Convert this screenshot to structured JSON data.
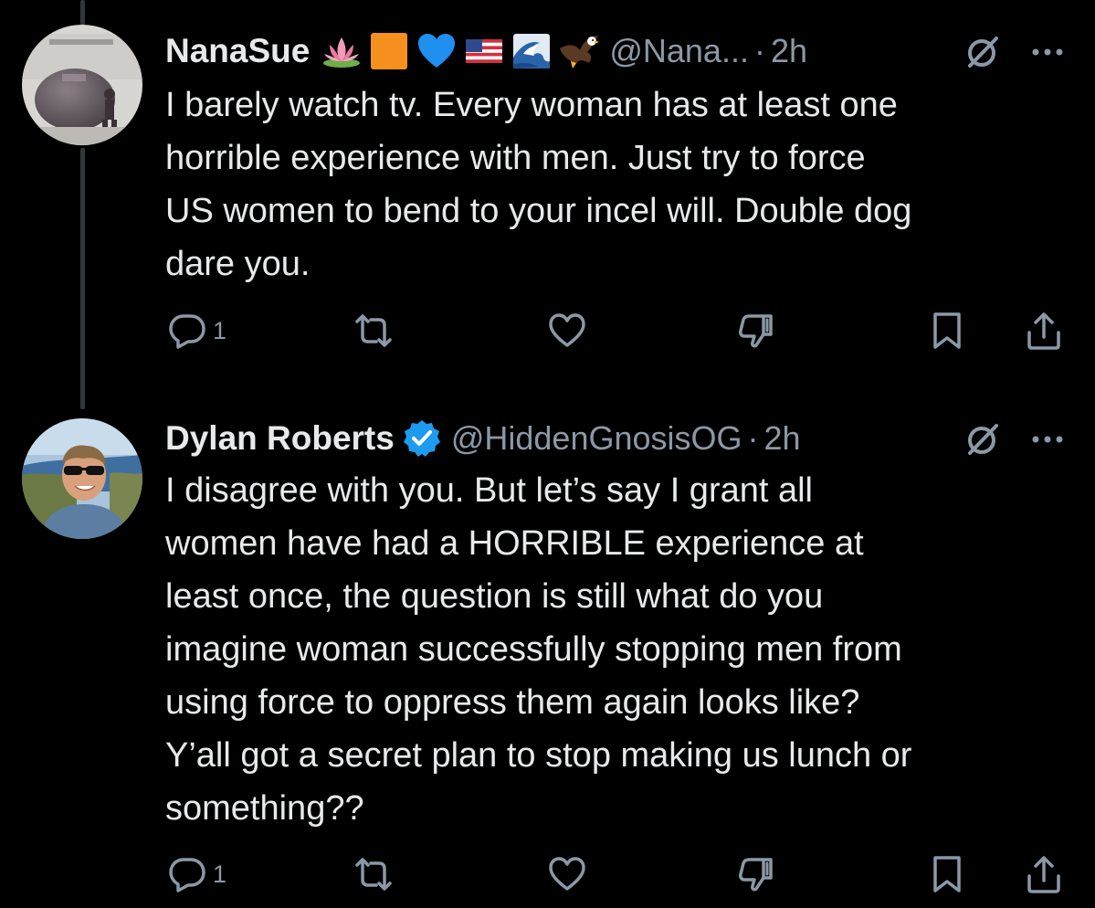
{
  "colors": {
    "background": "#000000",
    "primary_text": "#e7e9ea",
    "secondary_text": "#8b98a5",
    "thread_line": "#333639",
    "verified_blue": "#1d9bf0"
  },
  "tweets": [
    {
      "display_name": "NanaSue",
      "name_emojis": [
        "lotus-icon",
        "orange-square-icon",
        "blue-heart-icon",
        "us-flag-icon",
        "wave-icon",
        "eagle-icon"
      ],
      "verified": false,
      "handle": "@Nana...",
      "separator": "·",
      "time": "2h",
      "text": "I barely watch tv. Every woman has at least one\nhorrible experience with men. Just try to force\nUS women to bend to your incel will. Double dog\ndare you.",
      "reply_count": "1"
    },
    {
      "display_name": "Dylan Roberts",
      "verified": true,
      "handle": "@HiddenGnosisOG",
      "separator": "·",
      "time": "2h",
      "text": "I disagree with you. But let’s say I grant all\nwomen have had a HORRIBLE experience at\nleast once, the question is still what do you\nimagine woman successfully stopping men from\nusing force to oppress them again looks like?\nY’all got a secret plan to stop making us lunch or\nsomething??",
      "reply_count": "1"
    }
  ]
}
